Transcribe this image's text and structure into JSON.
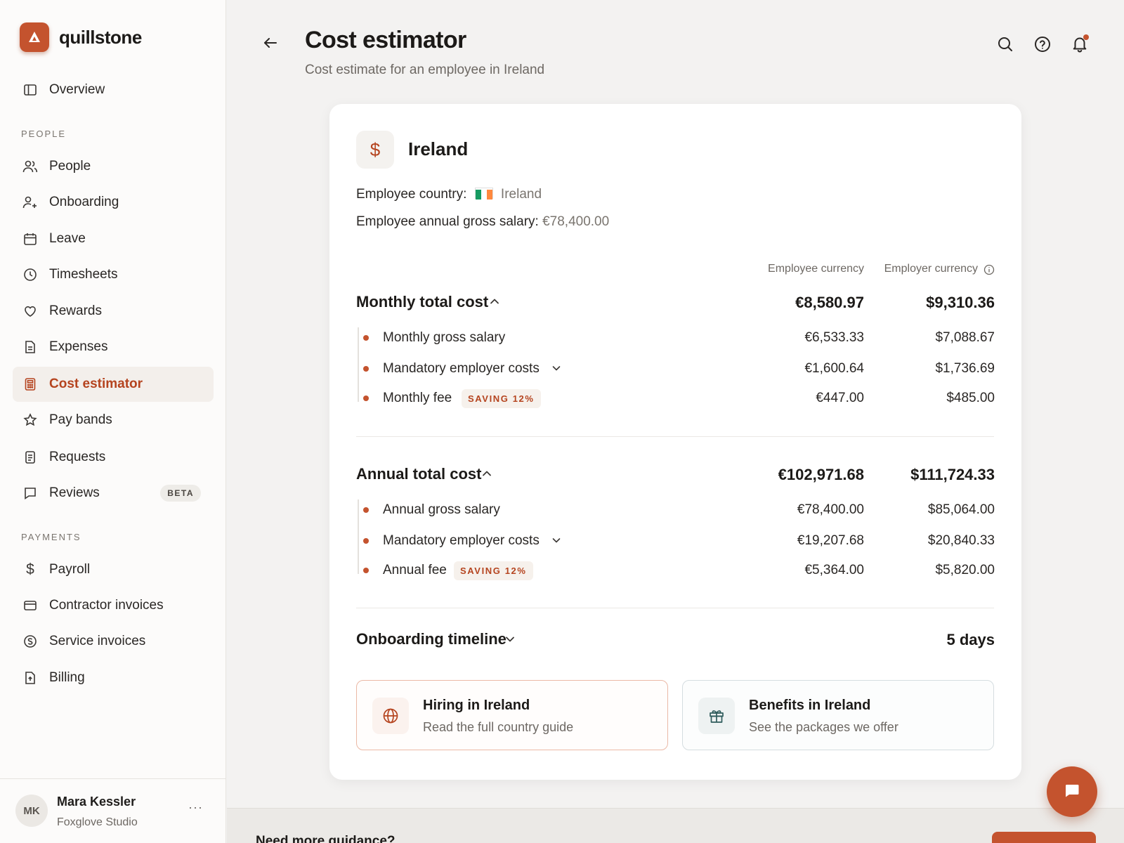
{
  "app": {
    "brand": "quillstone"
  },
  "sidebar": {
    "overview": "Overview",
    "people_section": "PEOPLE",
    "people_items": [
      "People",
      "Onboarding",
      "Leave",
      "Timesheets",
      "Rewards",
      "Expenses",
      "Cost estimator",
      "Pay bands",
      "Requests",
      "Reviews"
    ],
    "reviews_badge": "BETA",
    "payments_section": "PAYMENTS",
    "payments_items": [
      "Payroll",
      "Contractor invoices",
      "Service invoices",
      "Billing"
    ],
    "active_item": "Cost estimator"
  },
  "user": {
    "initials": "MK",
    "name": "Mara Kessler",
    "org": "Foxglove Studio",
    "menu": "···"
  },
  "header": {
    "title": "Cost estimator",
    "subtitle": "Cost estimate for an employee in Ireland",
    "icons": [
      "search-icon",
      "help-icon",
      "bell-icon"
    ]
  },
  "estimate": {
    "country_title": "Ireland",
    "country_icon": "$",
    "employee_country_label": "Employee country:",
    "employee_country_value": "Ireland",
    "salary_label": "Employee annual gross salary:",
    "salary_value": "€78,400.00",
    "col_employee": "Employee currency",
    "col_employer": "Employer currency",
    "monthly": {
      "title": "Monthly total cost",
      "total_employee": "€8,580.97",
      "total_employer": "$9,310.36",
      "rows": [
        {
          "label": "Monthly gross salary",
          "employee": "€6,533.33",
          "employer": "$7,088.67"
        },
        {
          "label": "Mandatory employer costs",
          "employee": "€1,600.64",
          "employer": "$1,736.69"
        },
        {
          "label": "Monthly fee",
          "badge": "SAVING 12%",
          "employee": "€447.00",
          "employer": "$485.00"
        }
      ]
    },
    "annual": {
      "title": "Annual total cost",
      "total_employee": "€102,971.68",
      "total_employer": "$111,724.33",
      "rows": [
        {
          "label": "Annual gross salary",
          "employee": "€78,400.00",
          "employer": "$85,064.00"
        },
        {
          "label": "Mandatory employer costs",
          "employee": "€19,207.68",
          "employer": "$20,840.33"
        },
        {
          "label": "Annual fee",
          "badge": "SAVING 12%",
          "employee": "€5,364.00",
          "employer": "$5,820.00"
        }
      ]
    },
    "onboarding": {
      "title": "Onboarding timeline",
      "value": "5 days"
    },
    "links": [
      {
        "title": "Hiring in Ireland",
        "subtitle": "Read the full country guide",
        "icon": "globe-icon"
      },
      {
        "title": "Benefits in Ireland",
        "subtitle": "See the packages we offer",
        "icon": "gift-icon"
      }
    ]
  },
  "footer": {
    "text": "Need more guidance?"
  },
  "colors": {
    "accent": "#c4532e",
    "accent_text": "#b5441f",
    "background": "#f3f2f1"
  }
}
